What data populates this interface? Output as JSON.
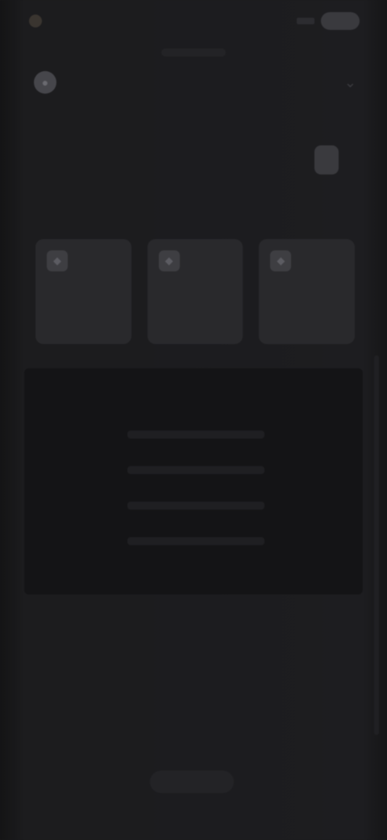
{
  "status": {
    "time": "",
    "battery": ""
  },
  "browser": {
    "url": ""
  },
  "header": {
    "title": "",
    "logo_icon": "app-logo-icon",
    "menu_icon": "chevron-down-icon"
  },
  "tabs": [
    {
      "label": ""
    },
    {
      "label": ""
    },
    {
      "label": ""
    },
    {
      "label": ""
    },
    {
      "label": ""
    },
    {
      "label": "",
      "active": true
    }
  ],
  "section": {
    "label": ""
  },
  "cards": [
    {
      "icon": "card-icon",
      "label": ""
    },
    {
      "icon": "card-icon",
      "label": ""
    },
    {
      "icon": "card-icon",
      "label": ""
    }
  ],
  "table": {
    "columns": [
      "",
      "",
      "",
      ""
    ],
    "rows": [
      {
        "name": "",
        "detail": "",
        "value": "",
        "extra": ""
      },
      {
        "name": "",
        "detail": "",
        "value": "",
        "extra": ""
      },
      {
        "name": "",
        "detail": "",
        "value": "",
        "extra": ""
      },
      {
        "name": "",
        "detail": "",
        "value": "",
        "extra": ""
      }
    ]
  },
  "content": {
    "line1": "",
    "line2": ""
  },
  "footer": {
    "button_label": ""
  },
  "colors": {
    "background": "#1a1a1c",
    "card": "#29292c",
    "table": "#141416"
  }
}
